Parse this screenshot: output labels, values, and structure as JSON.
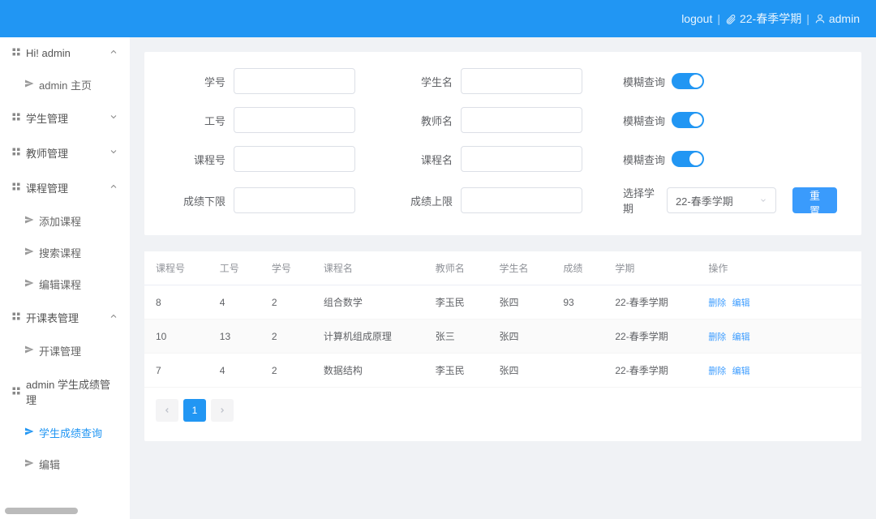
{
  "header": {
    "logout": "logout",
    "term": "22-春季学期",
    "user": "admin"
  },
  "sidebar": {
    "greeting": "Hi! admin",
    "home": "admin 主页",
    "student_mgmt": "学生管理",
    "teacher_mgmt": "教师管理",
    "course_mgmt": "课程管理",
    "course_add": "添加课程",
    "course_search": "搜索课程",
    "course_edit": "编辑课程",
    "schedule_mgmt": "开课表管理",
    "schedule_manage": "开课管理",
    "grade_mgmt": "admin 学生成绩管理",
    "grade_query": "学生成绩查询",
    "grade_edit": "编辑"
  },
  "filters": {
    "student_id_label": "学号",
    "student_name_label": "学生名",
    "teacher_id_label": "工号",
    "teacher_name_label": "教师名",
    "course_id_label": "课程号",
    "course_name_label": "课程名",
    "grade_min_label": "成绩下限",
    "grade_max_label": "成绩上限",
    "fuzzy_label": "模糊查询",
    "term_label": "选择学期",
    "term_value": "22-春季学期",
    "reset": "重置"
  },
  "table": {
    "headers": {
      "course_id": "课程号",
      "teacher_id": "工号",
      "student_id": "学号",
      "course_name": "课程名",
      "teacher_name": "教师名",
      "student_name": "学生名",
      "grade": "成绩",
      "term": "学期",
      "actions": "操作"
    },
    "rows": [
      {
        "course_id": "8",
        "teacher_id": "4",
        "student_id": "2",
        "course_name": "组合数学",
        "teacher_name": "李玉民",
        "student_name": "张四",
        "grade": "93",
        "term": "22-春季学期"
      },
      {
        "course_id": "10",
        "teacher_id": "13",
        "student_id": "2",
        "course_name": "计算机组成原理",
        "teacher_name": "张三",
        "student_name": "张四",
        "grade": "",
        "term": "22-春季学期"
      },
      {
        "course_id": "7",
        "teacher_id": "4",
        "student_id": "2",
        "course_name": "数据结构",
        "teacher_name": "李玉民",
        "student_name": "张四",
        "grade": "",
        "term": "22-春季学期"
      }
    ],
    "action_delete": "删除",
    "action_edit": "编辑"
  },
  "pagination": {
    "current": "1"
  }
}
